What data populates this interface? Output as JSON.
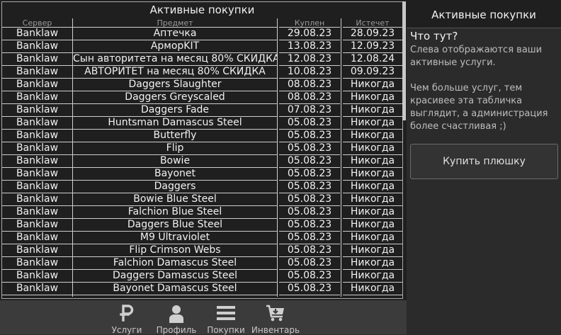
{
  "table": {
    "title": "Активные покупки",
    "headers": [
      "Сервер",
      "Предмет",
      "Куплен",
      "Истечет"
    ],
    "rows": [
      [
        "Banklaw",
        "Аптечка",
        "29.08.23",
        "28.09.23"
      ],
      [
        "Banklaw",
        "АрморKIT",
        "13.08.23",
        "12.09.23"
      ],
      [
        "Banklaw",
        "Сын авторитета на месяц 80% СКИДКА",
        "12.08.23",
        "12.08.24"
      ],
      [
        "Banklaw",
        "АВТОРИТЕТ на месяц 80% СКИДКА",
        "10.08.23",
        "09.09.23"
      ],
      [
        "Banklaw",
        "Daggers Slaughter",
        "08.08.23",
        "Никогда"
      ],
      [
        "Banklaw",
        "Daggers Greyscaled",
        "08.08.23",
        "Никогда"
      ],
      [
        "Banklaw",
        "Daggers Fade",
        "07.08.23",
        "Никогда"
      ],
      [
        "Banklaw",
        "Huntsman Damascus Steel",
        "05.08.23",
        "Никогда"
      ],
      [
        "Banklaw",
        "Butterfly",
        "05.08.23",
        "Никогда"
      ],
      [
        "Banklaw",
        "Flip",
        "05.08.23",
        "Никогда"
      ],
      [
        "Banklaw",
        "Bowie",
        "05.08.23",
        "Никогда"
      ],
      [
        "Banklaw",
        "Bayonet",
        "05.08.23",
        "Никогда"
      ],
      [
        "Banklaw",
        "Daggers",
        "05.08.23",
        "Никогда"
      ],
      [
        "Banklaw",
        "Bowie Blue Steel",
        "05.08.23",
        "Никогда"
      ],
      [
        "Banklaw",
        "Falchion Blue Steel",
        "05.08.23",
        "Никогда"
      ],
      [
        "Banklaw",
        "Daggers Blue Steel",
        "05.08.23",
        "Никогда"
      ],
      [
        "Banklaw",
        "M9 Ultraviolet",
        "05.08.23",
        "Никогда"
      ],
      [
        "Banklaw",
        "Flip Crimson Webs",
        "05.08.23",
        "Никогда"
      ],
      [
        "Banklaw",
        "Falchion Damascus Steel",
        "05.08.23",
        "Никогда"
      ],
      [
        "Banklaw",
        "Daggers Damascus Steel",
        "05.08.23",
        "Никогда"
      ],
      [
        "Banklaw",
        "Bayonet Damascus Steel",
        "05.08.23",
        "Никогда"
      ]
    ]
  },
  "nav": {
    "items": [
      {
        "label": "Услуги",
        "icon": "ruble-icon"
      },
      {
        "label": "Профиль",
        "icon": "user-icon"
      },
      {
        "label": "Покупки",
        "icon": "menu-icon"
      },
      {
        "label": "Инвентарь",
        "icon": "cart-icon"
      }
    ]
  },
  "sidebar": {
    "header": "Активные покупки",
    "info_title": "Что тут?",
    "info_text": "Слева отображаются ваши активные услуги.\n\nЧем больше услуг, тем красивее эта табличка выглядит, а администрация более счастливая ;)",
    "buy_label": "Купить плюшку"
  }
}
